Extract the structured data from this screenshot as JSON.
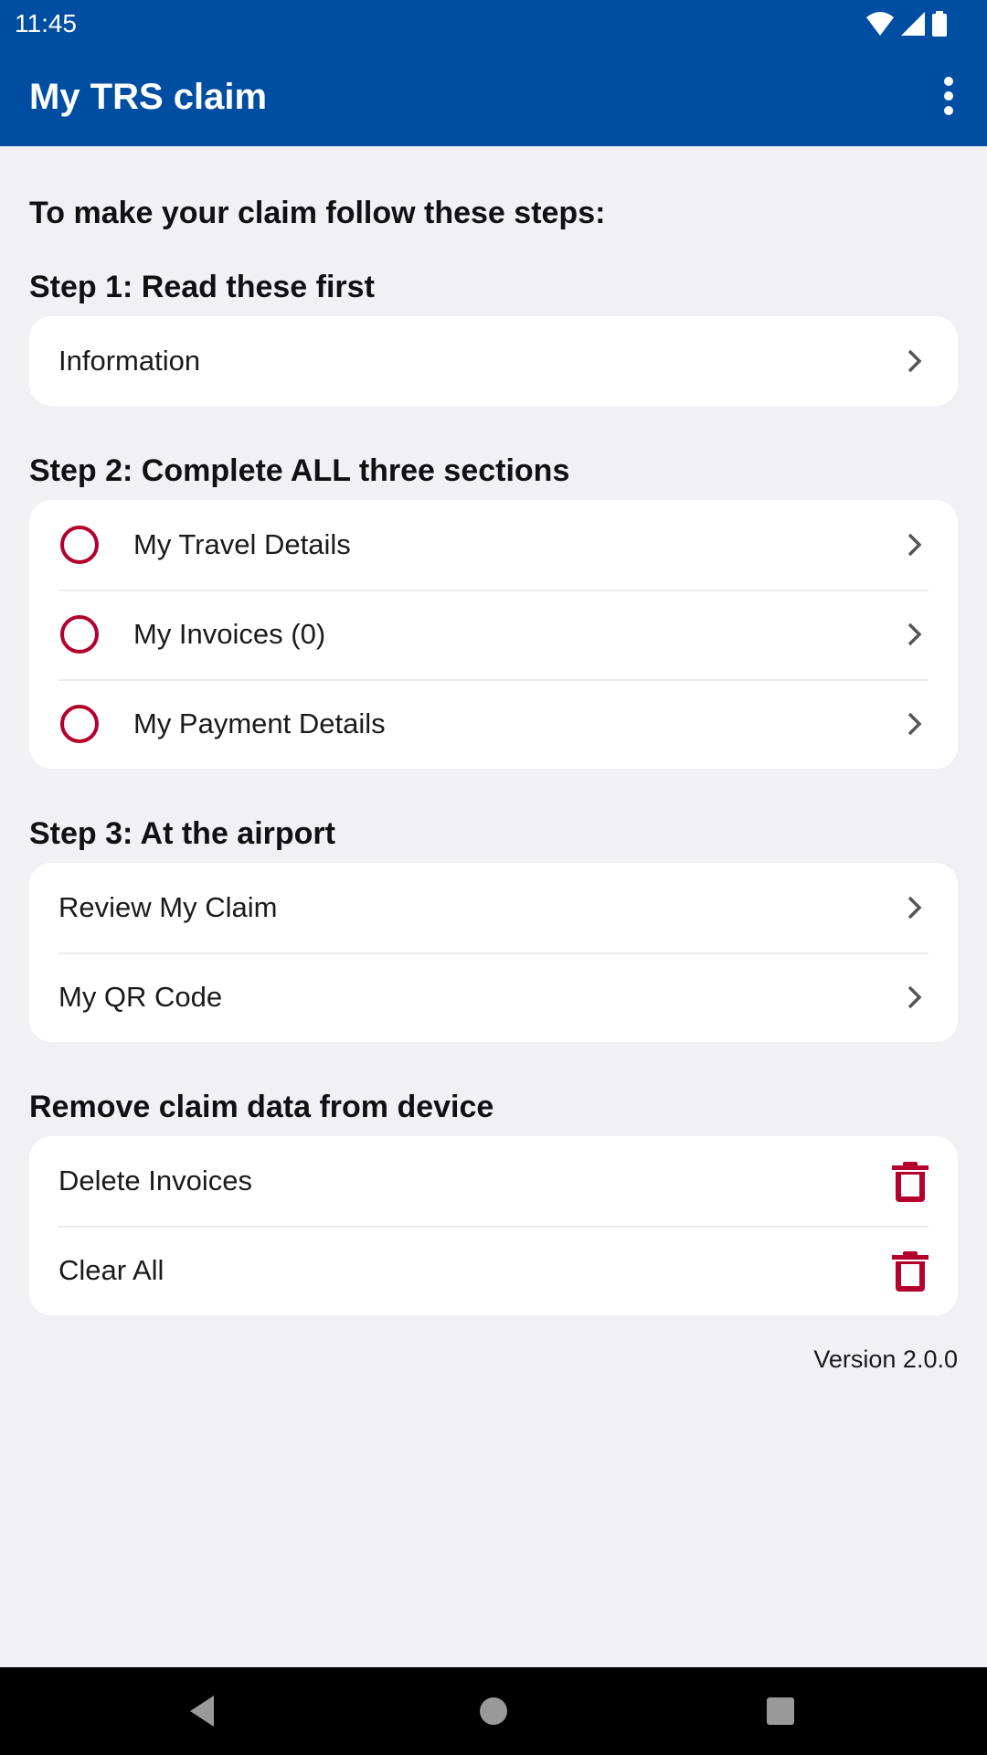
{
  "status_bar": {
    "time": "11:45",
    "icons": [
      "wifi-icon",
      "signal-icon",
      "battery-icon"
    ]
  },
  "app_bar": {
    "title": "My TRS claim",
    "menu_icon": "more-vert-icon"
  },
  "intro": "To make your claim follow these steps:",
  "step1": {
    "heading": "Step 1: Read these first",
    "items": [
      {
        "label": "Information"
      }
    ]
  },
  "step2": {
    "heading": "Step 2: Complete ALL three sections",
    "items": [
      {
        "label": "My Travel Details",
        "status": "incomplete"
      },
      {
        "label": "My Invoices (0)",
        "status": "incomplete"
      },
      {
        "label": "My Payment Details",
        "status": "incomplete"
      }
    ]
  },
  "step3": {
    "heading": "Step 3: At the airport",
    "items": [
      {
        "label": "Review My Claim"
      },
      {
        "label": "My QR Code"
      }
    ]
  },
  "remove": {
    "heading": "Remove claim data from device",
    "items": [
      {
        "label": "Delete Invoices"
      },
      {
        "label": "Clear All"
      }
    ]
  },
  "version": "Version 2.0.0",
  "colors": {
    "primary": "#004ea2",
    "accent": "#b3002d",
    "background": "#f0f0f5"
  },
  "nav": {
    "back": "back-icon",
    "home": "home-icon",
    "recents": "recents-icon"
  }
}
